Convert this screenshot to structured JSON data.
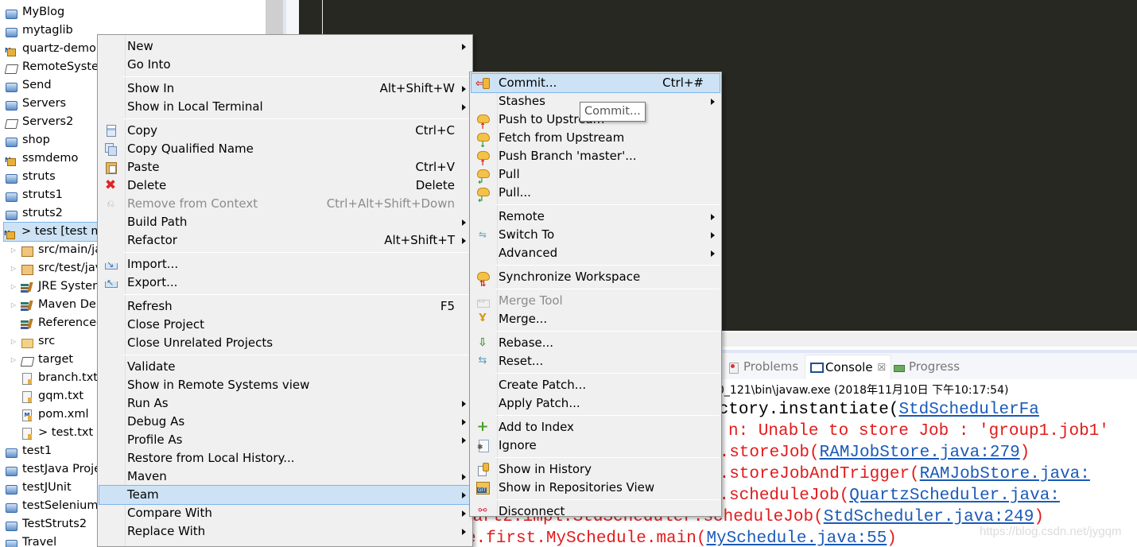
{
  "explorer": {
    "items": [
      {
        "label": "MyBlog",
        "icon": "folder-closed",
        "indent": 0
      },
      {
        "label": "mytaglib",
        "icon": "folder-closed",
        "indent": 0
      },
      {
        "label": "quartz-demo",
        "icon": "maven-project",
        "indent": 0
      },
      {
        "label": "RemoteSystemsTempFiles",
        "icon": "folder-open",
        "indent": 0
      },
      {
        "label": "Send",
        "icon": "folder-closed",
        "indent": 0
      },
      {
        "label": "Servers",
        "icon": "folder-closed",
        "indent": 0
      },
      {
        "label": "Servers2",
        "icon": "folder-open",
        "indent": 0
      },
      {
        "label": "shop",
        "icon": "folder-closed",
        "indent": 0
      },
      {
        "label": "ssmdemo",
        "icon": "maven-project",
        "indent": 0
      },
      {
        "label": "struts",
        "icon": "folder-closed",
        "indent": 0
      },
      {
        "label": "struts1",
        "icon": "folder-closed",
        "indent": 0
      },
      {
        "label": "struts2",
        "icon": "folder-closed",
        "indent": 0
      },
      {
        "label": "> test [test m",
        "icon": "maven-project",
        "indent": 0,
        "selected": true
      },
      {
        "label": "src/main/java",
        "icon": "package",
        "indent": 1,
        "twisty": true
      },
      {
        "label": "src/test/java",
        "icon": "package",
        "indent": 1,
        "twisty": true
      },
      {
        "label": "JRE System Library",
        "icon": "library",
        "indent": 1,
        "twisty": true
      },
      {
        "label": "Maven Dependencies",
        "icon": "library",
        "indent": 1,
        "twisty": true
      },
      {
        "label": "Referenced Libraries",
        "icon": "library",
        "indent": 1
      },
      {
        "label": "src",
        "icon": "folder-yellow",
        "indent": 1,
        "twisty": true
      },
      {
        "label": "target",
        "icon": "folder-open",
        "indent": 1,
        "twisty": true
      },
      {
        "label": "branch.txt",
        "icon": "file",
        "indent": 1
      },
      {
        "label": "gqm.txt",
        "icon": "file",
        "indent": 1
      },
      {
        "label": "pom.xml",
        "icon": "xml-file",
        "indent": 1
      },
      {
        "label": "> test.txt",
        "icon": "file",
        "indent": 1
      },
      {
        "label": "test1",
        "icon": "folder-closed",
        "indent": 0
      },
      {
        "label": "testJava Project",
        "icon": "folder-closed",
        "indent": 0
      },
      {
        "label": "testJUnit",
        "icon": "folder-closed",
        "indent": 0
      },
      {
        "label": "testSelenium",
        "icon": "folder-closed",
        "indent": 0
      },
      {
        "label": "TestStruts2",
        "icon": "folder-closed",
        "indent": 0
      },
      {
        "label": "Travel",
        "icon": "folder-closed",
        "indent": 0
      }
    ]
  },
  "context_menu": {
    "items": [
      {
        "label": "New",
        "submenu": true
      },
      {
        "label": "Go Into"
      },
      {
        "separator": true
      },
      {
        "label": "Show In",
        "accel": "Alt+Shift+W",
        "submenu": true
      },
      {
        "label": "Show in Local Terminal",
        "submenu": true
      },
      {
        "separator": true
      },
      {
        "label": "Copy",
        "accel": "Ctrl+C",
        "icon": "copy"
      },
      {
        "label": "Copy Qualified Name",
        "icon": "copy-qualified"
      },
      {
        "label": "Paste",
        "accel": "Ctrl+V",
        "icon": "paste"
      },
      {
        "label": "Delete",
        "accel": "Delete",
        "icon": "delete"
      },
      {
        "label": "Remove from Context",
        "accel": "Ctrl+Alt+Shift+Down",
        "icon": "remove-context",
        "disabled": true
      },
      {
        "label": "Build Path",
        "submenu": true
      },
      {
        "label": "Refactor",
        "accel": "Alt+Shift+T",
        "submenu": true
      },
      {
        "separator": true
      },
      {
        "label": "Import...",
        "icon": "import"
      },
      {
        "label": "Export...",
        "icon": "export"
      },
      {
        "separator": true
      },
      {
        "label": "Refresh",
        "accel": "F5"
      },
      {
        "label": "Close Project"
      },
      {
        "label": "Close Unrelated Projects"
      },
      {
        "separator": true
      },
      {
        "label": "Validate"
      },
      {
        "label": "Show in Remote Systems view"
      },
      {
        "label": "Run As",
        "submenu": true
      },
      {
        "label": "Debug As",
        "submenu": true
      },
      {
        "label": "Profile As",
        "submenu": true
      },
      {
        "label": "Restore from Local History..."
      },
      {
        "label": "Maven",
        "submenu": true
      },
      {
        "label": "Team",
        "submenu": true,
        "hover": true
      },
      {
        "label": "Compare With",
        "submenu": true
      },
      {
        "label": "Replace With",
        "submenu": true
      }
    ]
  },
  "team_menu": {
    "items": [
      {
        "label": "Commit...",
        "accel": "Ctrl+#",
        "icon": "commit",
        "hover": true
      },
      {
        "label": "Stashes",
        "submenu": true
      },
      {
        "label": "Push to Upstream",
        "icon": "cloud-up"
      },
      {
        "label": "Fetch from Upstream",
        "icon": "cloud-down"
      },
      {
        "label": "Push Branch 'master'...",
        "icon": "cloud-up"
      },
      {
        "label": "Pull",
        "icon": "cloud-pull"
      },
      {
        "label": "Pull...",
        "icon": "cloud-pull"
      },
      {
        "separator": true
      },
      {
        "label": "Remote",
        "submenu": true
      },
      {
        "label": "Switch To",
        "submenu": true,
        "icon": "switch"
      },
      {
        "label": "Advanced",
        "submenu": true
      },
      {
        "separator": true
      },
      {
        "label": "Synchronize Workspace",
        "icon": "cloud-sync"
      },
      {
        "separator": true
      },
      {
        "label": "Merge Tool",
        "icon": "merge-tool",
        "disabled": true
      },
      {
        "label": "Merge...",
        "icon": "merge"
      },
      {
        "separator": true
      },
      {
        "label": "Rebase...",
        "icon": "rebase"
      },
      {
        "label": "Reset...",
        "icon": "reset"
      },
      {
        "separator": true
      },
      {
        "label": "Create Patch..."
      },
      {
        "label": "Apply Patch..."
      },
      {
        "separator": true
      },
      {
        "label": "Add to Index",
        "icon": "add-index"
      },
      {
        "label": "Ignore",
        "icon": "ignore"
      },
      {
        "separator": true
      },
      {
        "label": "Show in History",
        "icon": "history"
      },
      {
        "label": "Show in Repositories View",
        "icon": "repositories"
      },
      {
        "separator": true
      },
      {
        "label": "Disconnect",
        "icon": "disconnect"
      }
    ]
  },
  "tooltip": {
    "text": "Commit..."
  },
  "console": {
    "tabs": [
      {
        "label": "Problems",
        "icon": "problems"
      },
      {
        "label": "Console",
        "icon": "console",
        "active": true,
        "close": "☒"
      },
      {
        "label": "Progress",
        "icon": "progress"
      }
    ],
    "header": "0_121\\bin\\javaw.exe (2018年11月10日 下午10:17:54)",
    "lines": [
      {
        "prefix": "ulerFactory.instantiate(",
        "link": "StdSchedulerFa",
        "suffix": "",
        "color": "black"
      },
      {
        "prefix": "n: Unable to store Job : 'group1.job1'",
        "link": "",
        "suffix": "",
        "color": "red"
      },
      {
        "prefix": "e.storeJob(",
        "link": "RAMJobStore.java:279",
        "suffix": ")",
        "color": "red"
      },
      {
        "prefix": "e.storeJobAndTrigger(",
        "link": "RAMJobStore.java:",
        "suffix": "",
        "color": "red"
      },
      {
        "prefix": "uler.scheduleJob(",
        "link": "QuartzScheduler.java:",
        "suffix": "",
        "color": "red"
      },
      {
        "prefix": "uartz.impl.StdScheduler.scheduleJob(",
        "link": "StdScheduler.java:249",
        "suffix": ")",
        "color": "red"
      },
      {
        "prefix": "e.first.MySchedule.main(",
        "link": "MySchedule.java:55",
        "suffix": ")",
        "color": "red"
      }
    ]
  },
  "watermark": "https://blog.csdn.net/jygqm"
}
